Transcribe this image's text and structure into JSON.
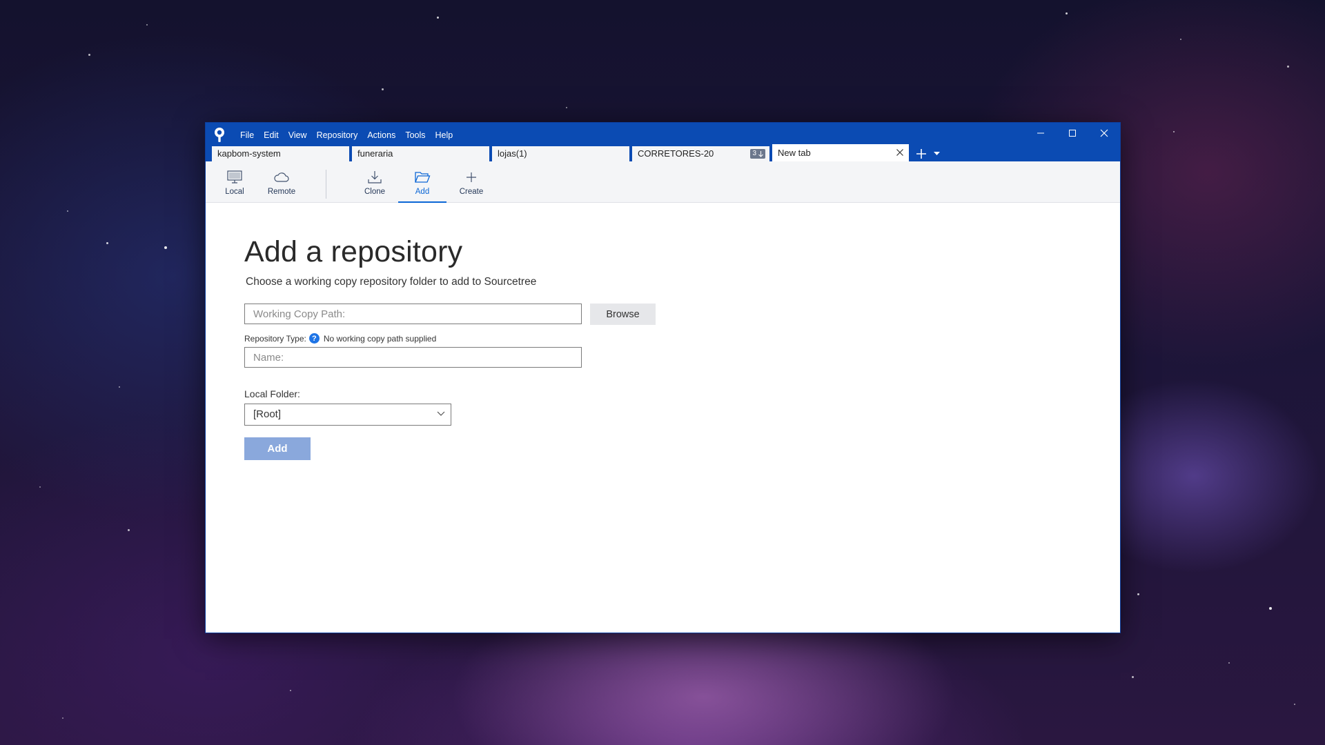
{
  "window": {
    "menu": [
      "File",
      "Edit",
      "View",
      "Repository",
      "Actions",
      "Tools",
      "Help"
    ],
    "tabs": [
      {
        "label": "kapbom-system"
      },
      {
        "label": "funeraria"
      },
      {
        "label": "lojas(1)"
      },
      {
        "label": "CORRETORES-20",
        "badge": "3"
      },
      {
        "label": "New tab",
        "active": true
      }
    ]
  },
  "toolbar": {
    "items": [
      {
        "label": "Local",
        "icon": "monitor-icon"
      },
      {
        "label": "Remote",
        "icon": "cloud-icon"
      },
      {
        "label": "Clone",
        "icon": "download-icon"
      },
      {
        "label": "Add",
        "icon": "folder-open-icon",
        "active": true
      },
      {
        "label": "Create",
        "icon": "plus-icon"
      }
    ]
  },
  "page": {
    "title": "Add a repository",
    "subtitle": "Choose a working copy repository folder to add to Sourcetree",
    "working_copy_placeholder": "Working Copy Path:",
    "browse_label": "Browse",
    "repo_type_label": "Repository Type:",
    "repo_type_help": "?",
    "repo_type_value": "No working copy path supplied",
    "name_placeholder": "Name:",
    "local_folder_label": "Local Folder:",
    "local_folder_value": "[Root]",
    "add_label": "Add"
  },
  "colors": {
    "titlebar": "#0b4bb3",
    "accent": "#0b66d6",
    "add_button_disabled": "#8aa8dc"
  }
}
